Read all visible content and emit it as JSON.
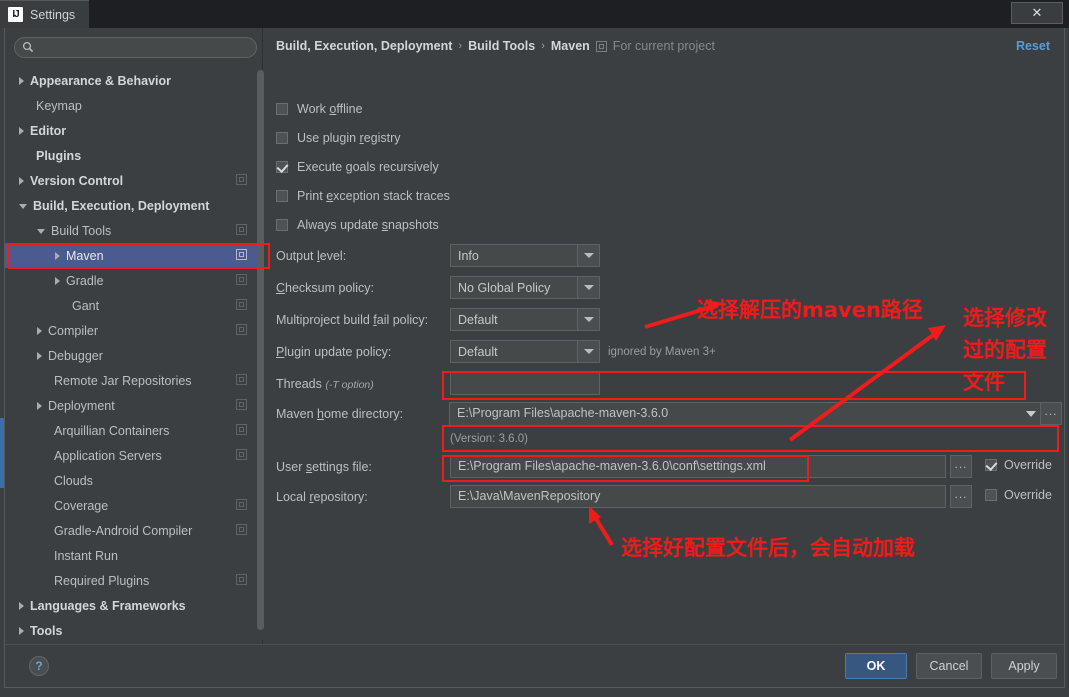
{
  "window": {
    "title": "Settings",
    "logo": "IJ",
    "close_label": "✕"
  },
  "sidebar": {
    "search_placeholder": "",
    "items": [
      {
        "label": "Appearance & Behavior",
        "indent": 0,
        "arrow": "right",
        "bold": true,
        "mod": false,
        "selected": false
      },
      {
        "label": "Keymap",
        "indent": 0,
        "arrow": "none",
        "bold": false,
        "mod": false,
        "selected": false
      },
      {
        "label": "Editor",
        "indent": 0,
        "arrow": "right",
        "bold": true,
        "mod": false,
        "selected": false
      },
      {
        "label": "Plugins",
        "indent": 0,
        "arrow": "none",
        "bold": true,
        "mod": false,
        "selected": false
      },
      {
        "label": "Version Control",
        "indent": 0,
        "arrow": "right",
        "bold": true,
        "mod": true,
        "selected": false
      },
      {
        "label": "Build, Execution, Deployment",
        "indent": 0,
        "arrow": "down",
        "bold": true,
        "mod": false,
        "selected": false
      },
      {
        "label": "Build Tools",
        "indent": 1,
        "arrow": "down",
        "bold": false,
        "mod": true,
        "selected": false
      },
      {
        "label": "Maven",
        "indent": 2,
        "arrow": "right",
        "bold": false,
        "mod": true,
        "selected": true
      },
      {
        "label": "Gradle",
        "indent": 2,
        "arrow": "right",
        "bold": false,
        "mod": true,
        "selected": false
      },
      {
        "label": "Gant",
        "indent": 2,
        "arrow": "none",
        "bold": false,
        "mod": true,
        "selected": false
      },
      {
        "label": "Compiler",
        "indent": 1,
        "arrow": "right",
        "bold": false,
        "mod": true,
        "selected": false
      },
      {
        "label": "Debugger",
        "indent": 1,
        "arrow": "right",
        "bold": false,
        "mod": false,
        "selected": false
      },
      {
        "label": "Remote Jar Repositories",
        "indent": 1,
        "arrow": "none",
        "bold": false,
        "mod": true,
        "selected": false
      },
      {
        "label": "Deployment",
        "indent": 1,
        "arrow": "right",
        "bold": false,
        "mod": true,
        "selected": false
      },
      {
        "label": "Arquillian Containers",
        "indent": 1,
        "arrow": "none",
        "bold": false,
        "mod": true,
        "selected": false
      },
      {
        "label": "Application Servers",
        "indent": 1,
        "arrow": "none",
        "bold": false,
        "mod": true,
        "selected": false
      },
      {
        "label": "Clouds",
        "indent": 1,
        "arrow": "none",
        "bold": false,
        "mod": false,
        "selected": false
      },
      {
        "label": "Coverage",
        "indent": 1,
        "arrow": "none",
        "bold": false,
        "mod": true,
        "selected": false
      },
      {
        "label": "Gradle-Android Compiler",
        "indent": 1,
        "arrow": "none",
        "bold": false,
        "mod": true,
        "selected": false
      },
      {
        "label": "Instant Run",
        "indent": 1,
        "arrow": "none",
        "bold": false,
        "mod": false,
        "selected": false
      },
      {
        "label": "Required Plugins",
        "indent": 1,
        "arrow": "none",
        "bold": false,
        "mod": true,
        "selected": false
      },
      {
        "label": "Languages & Frameworks",
        "indent": 0,
        "arrow": "right",
        "bold": true,
        "mod": false,
        "selected": false
      },
      {
        "label": "Tools",
        "indent": 0,
        "arrow": "right",
        "bold": true,
        "mod": false,
        "selected": false
      }
    ]
  },
  "header": {
    "crumb1": "Build, Execution, Deployment",
    "crumb2": "Build Tools",
    "crumb3": "Maven",
    "scope_note": "For current project",
    "sep": "›",
    "reset": "Reset"
  },
  "checkboxes": [
    {
      "label_pre": "Work ",
      "label_key": "o",
      "label_post": "ffline",
      "checked": false
    },
    {
      "label_pre": "Use plugin ",
      "label_key": "r",
      "label_post": "egistry",
      "checked": false
    },
    {
      "label_pre": "Execute ",
      "label_key": "g",
      "label_post": "oals recursively",
      "checked": true
    },
    {
      "label_pre": "Print ",
      "label_key": "e",
      "label_post": "xception stack traces",
      "checked": false
    },
    {
      "label_pre": "Always update ",
      "label_key": "s",
      "label_post": "napshots",
      "checked": false
    }
  ],
  "fields": {
    "output_level": {
      "label_pre": "Output ",
      "label_key": "l",
      "label_post": "evel:",
      "value": "Info"
    },
    "checksum_policy": {
      "label_pre": "",
      "label_key": "C",
      "label_post": "hecksum policy:",
      "value": "No Global Policy"
    },
    "multiproject_policy": {
      "label_pre": "Multiproject build ",
      "label_key": "f",
      "label_post": "ail policy:",
      "value": "Default"
    },
    "plugin_update_policy": {
      "label_pre": "",
      "label_key": "P",
      "label_post": "lugin update policy:",
      "value": "Default",
      "note": "ignored by Maven 3+"
    },
    "threads": {
      "label_pre": "Threads ",
      "label_hint": "(-T option)",
      "value": ""
    },
    "maven_home": {
      "label_pre": "Maven ",
      "label_key": "h",
      "label_post": "ome directory:",
      "value": "E:\\Program Files\\apache-maven-3.6.0",
      "version_note": "(Version: 3.6.0)"
    },
    "user_settings": {
      "label_pre": "User ",
      "label_key": "s",
      "label_post": "ettings file:",
      "value": "E:\\Program Files\\apache-maven-3.6.0\\conf\\settings.xml",
      "override_label": "Override",
      "override_checked": true,
      "browse": "..."
    },
    "local_repository": {
      "label_pre": "Local ",
      "label_key": "r",
      "label_post": "epository:",
      "value": "E:\\Java\\MavenRepository",
      "override_label": "Override",
      "override_checked": false,
      "browse": "..."
    }
  },
  "footer": {
    "help": "?",
    "ok": "OK",
    "cancel": "Cancel",
    "apply": "Apply"
  },
  "annotations": {
    "note_maven_path": "选择解压的maven路径",
    "note_modified_config_line1": "选择修改",
    "note_modified_config_line2": "过的配置",
    "note_modified_config_line3": "文件",
    "note_auto_load": "选择好配置文件后，会自动加载",
    "color": "#f01b1b"
  }
}
